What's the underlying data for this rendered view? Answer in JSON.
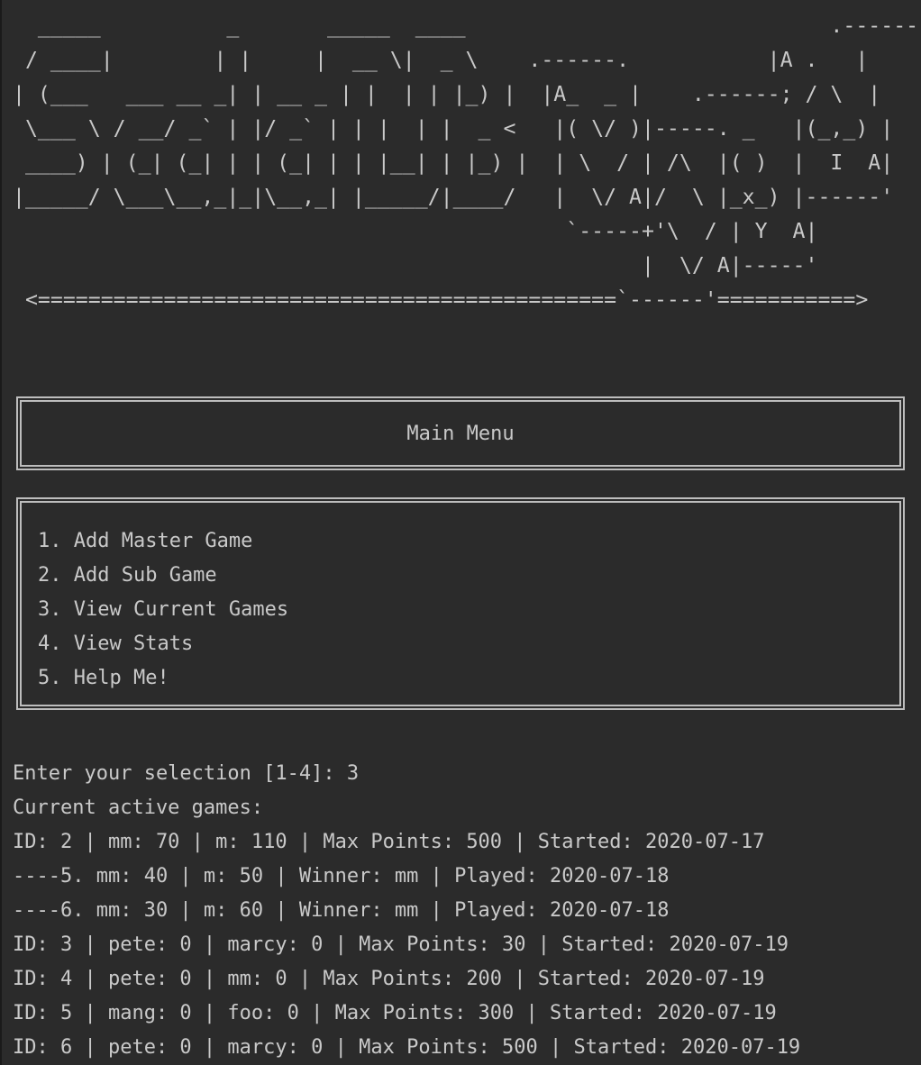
{
  "logo_art": "  _____          _       _____  ____                             .------.\n / ____|        | |     |  __ \\|  _ \\    .------.           |A .   |\n| (___   ___ __ _| | __ _ | |  | | |_) |  |A_  _ |    .------; / \\  |\n \\___ \\ / __/ _` | |/ _` | | |  | |  _ <   |( \\/ )|-----. _   |(_,_) |\n ____) | (_| (_| | | (_| | | |__| | |_) |  | \\  / | /\\  |( )  |  I  A|\n|_____/ \\___\\__,_|_|\\__,_| |_____/|____/   |  \\/ A|/  \\ |_x_) |------'\n                                            `-----+'\\  / | Y  A|\n                                                  |  \\/ A|-----'\n <==============================================`------'===========>",
  "title_box": {
    "title": "Main Menu"
  },
  "menu": {
    "items": [
      "1. Add Master Game",
      "2. Add Sub Game",
      "3. View Current Games",
      "4. View Stats",
      "5. Help Me!"
    ]
  },
  "output": {
    "prompt": "Enter your selection [1-4]: 3",
    "heading": "Current active games:",
    "lines": [
      "ID: 2 | mm: 70 | m: 110 | Max Points: 500 | Started: 2020-07-17",
      "----5. mm: 40 | m: 50 | Winner: mm | Played: 2020-07-18",
      "----6. mm: 30 | m: 60 | Winner: mm | Played: 2020-07-18",
      "ID: 3 | pete: 0 | marcy: 0 | Max Points: 30 | Started: 2020-07-19",
      "ID: 4 | pete: 0 | mm: 0 | Max Points: 200 | Started: 2020-07-19",
      "ID: 5 | mang: 0 | foo: 0 | Max Points: 300 | Started: 2020-07-19",
      "ID: 6 | pete: 0 | marcy: 0 | Max Points: 500 | Started: 2020-07-19"
    ]
  },
  "colors": {
    "background": "#2b2b2b",
    "text": "#c9c9c9",
    "border": "#bdbdbd"
  }
}
